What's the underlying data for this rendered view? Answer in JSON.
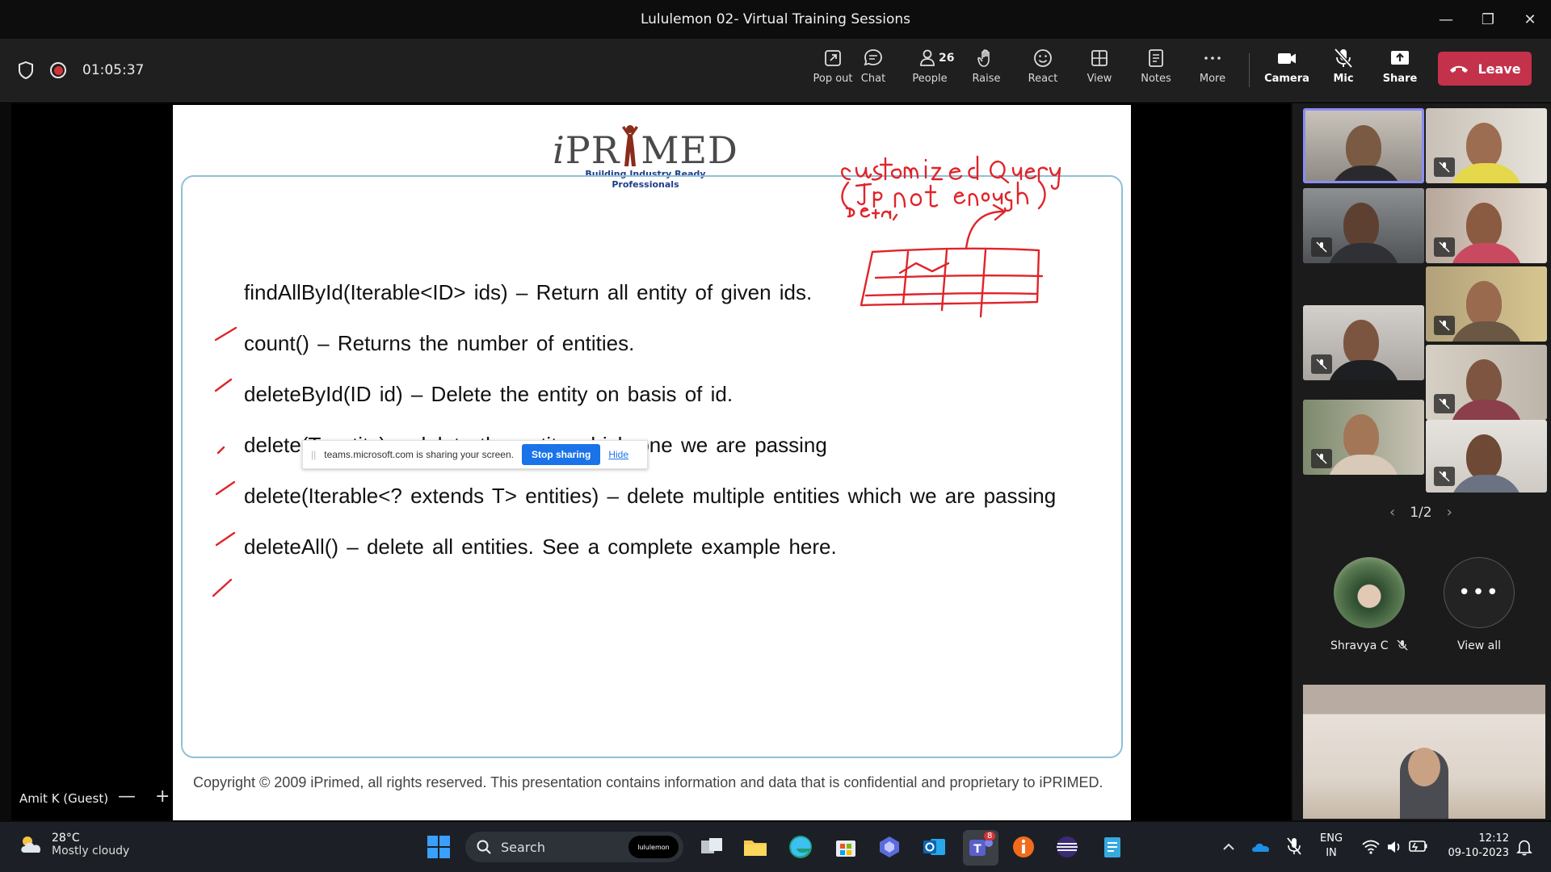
{
  "window": {
    "title": "Lululemon 02- Virtual Training Sessions",
    "minimize": "—",
    "restore": "❐",
    "close": "✕"
  },
  "meeting": {
    "timer": "01:05:37",
    "people_count": "26",
    "buttons": {
      "popout": "Pop out",
      "chat": "Chat",
      "people": "People",
      "raise": "Raise",
      "react": "React",
      "view": "View",
      "notes": "Notes",
      "more": "More",
      "camera": "Camera",
      "mic": "Mic",
      "share": "Share",
      "leave": "Leave"
    }
  },
  "slide": {
    "logo_i": "i",
    "logo_pr": "PR",
    "logo_m": "",
    "logo_rest": "MED",
    "tagline": "Building Industry Ready Professionals",
    "bullets": [
      "findAllById(Iterable<ID> ids)  – Return all entity of given ids.",
      "count() – Returns the number of entities.",
      "deleteById(ID id) – Delete the entity on basis of id.",
      "delete(T entity) – delete the entity which one we are passing",
      "delete(Iterable<? extends T> entities) – delete multiple entities which we are passing",
      "deleteAll() – delete all entities. See a complete example here."
    ],
    "copyright": "Copyright © 2009 iPrimed, all rights reserved. This presentation contains information  and data  that is confidential and proprietary to iPRIMED."
  },
  "share_banner": {
    "grip": "||",
    "message": "teams.microsoft.com is sharing your screen.",
    "stop": "Stop sharing",
    "hide": "Hide"
  },
  "presenter": {
    "name": "Amit K (Guest)",
    "zoom_out": "—",
    "zoom_in": "+"
  },
  "gallery": {
    "page": "1/2",
    "prev": "‹",
    "next": "›",
    "named_participant": "Shravya C",
    "view_all": "View all",
    "view_all_glyph": "•••"
  },
  "taskbar": {
    "temp": "28°C",
    "condition": "Mostly cloudy",
    "search": "Search",
    "search_badge": "lululemon",
    "teams_badge": "8",
    "lang_top": "ENG",
    "lang_bottom": "IN",
    "time": "12:12",
    "date": "09-10-2023"
  },
  "colors": {
    "leave": "#c4314b",
    "accent": "#8b8cf5",
    "ink": "#e0242a",
    "stop_sharing": "#1a73e8"
  }
}
